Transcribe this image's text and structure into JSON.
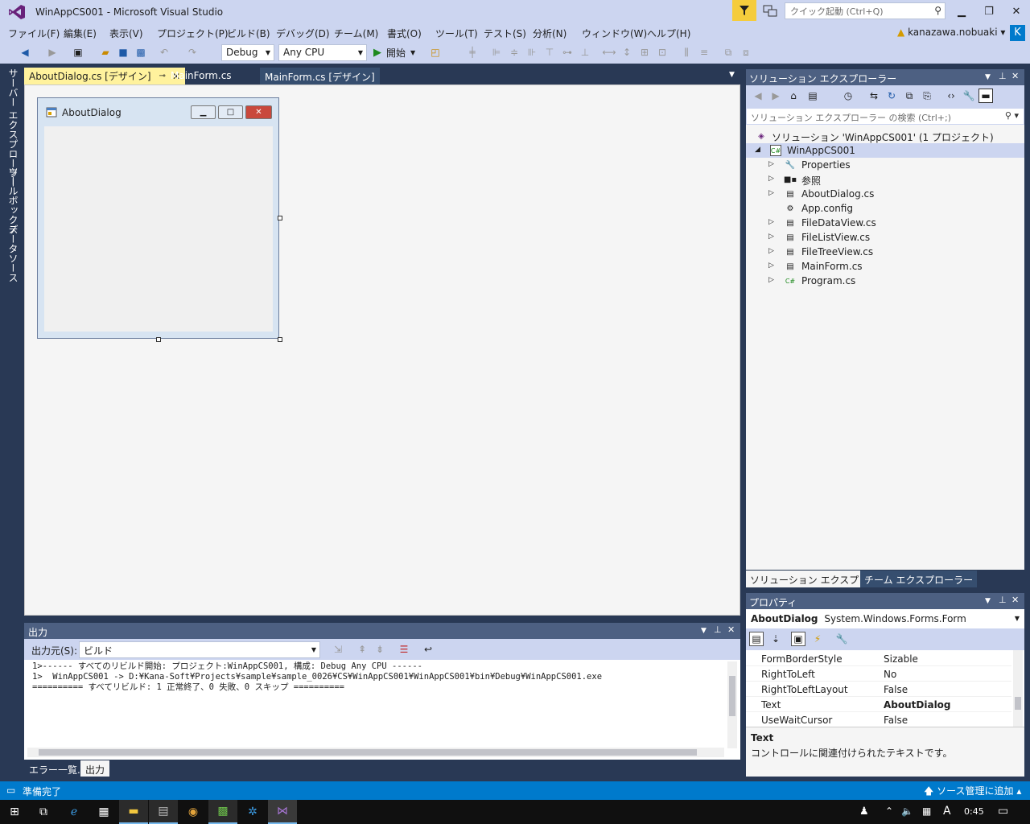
{
  "window": {
    "title": "WinAppCS001 - Microsoft Visual Studio",
    "quick_launch_placeholder": "クイック起動 (Ctrl+Q)"
  },
  "menu": [
    "ファイル(F)",
    "編集(E)",
    "表示(V)",
    "プロジェクト(P)",
    "ビルド(B)",
    "デバッグ(D)",
    "チーム(M)",
    "書式(O)",
    "ツール(T)",
    "テスト(S)",
    "分析(N)",
    "ウィンドウ(W)",
    "ヘルプ(H)"
  ],
  "user": {
    "name": "kanazawa.nobuaki",
    "initial": "K"
  },
  "toolbar": {
    "config": "Debug",
    "platform": "Any CPU",
    "start_label": "開始"
  },
  "side_tabs": [
    "サーバー エクスプローラー",
    "ツールボックス",
    "データソース"
  ],
  "doc_tabs": [
    "AboutDialog.cs [デザイン]",
    "MainForm.cs",
    "MainForm.cs [デザイン]"
  ],
  "form": {
    "title": "AboutDialog"
  },
  "output": {
    "header": "出力",
    "source_label": "出力元(S):",
    "source_value": "ビルド",
    "lines": [
      "1>------ すべてのリビルド開始: プロジェクト:WinAppCS001, 構成: Debug Any CPU ------",
      "1>  WinAppCS001 -> D:¥Kana-Soft¥Projects¥sample¥sample_0026¥CS¥WinAppCS001¥WinAppCS001¥bin¥Debug¥WinAppCS001.exe",
      "========== すべてリビルド: 1 正常終了、0 失敗、0 スキップ =========="
    ],
    "tabs": [
      "エラー一覧...",
      "出力"
    ]
  },
  "solution_explorer": {
    "header": "ソリューション エクスプローラー",
    "search_placeholder": "ソリューション エクスプローラー の検索 (Ctrl+;)",
    "solution": "ソリューション 'WinAppCS001' (1 プロジェクト)",
    "project": "WinAppCS001",
    "items": [
      "Properties",
      "参照",
      "AboutDialog.cs",
      "App.config",
      "FileDataView.cs",
      "FileListView.cs",
      "FileTreeView.cs",
      "MainForm.cs",
      "Program.cs"
    ],
    "tabs": [
      "ソリューション エクスプローラー",
      "チーム エクスプローラー"
    ]
  },
  "properties": {
    "header": "プロパティ",
    "object_name": "AboutDialog",
    "object_type": "System.Windows.Forms.Form",
    "rows": [
      {
        "name": "FormBorderStyle",
        "value": "Sizable"
      },
      {
        "name": "RightToLeft",
        "value": "No"
      },
      {
        "name": "RightToLeftLayout",
        "value": "False"
      },
      {
        "name": "Text",
        "value": "AboutDialog"
      },
      {
        "name": "UseWaitCursor",
        "value": "False"
      }
    ],
    "desc_title": "Text",
    "desc_text": "コントロールに関連付けられたテキストです。"
  },
  "status": {
    "left": "準備完了",
    "right": "ソース管理に追加"
  },
  "taskbar": {
    "time": "0:45",
    "ime": "A"
  }
}
